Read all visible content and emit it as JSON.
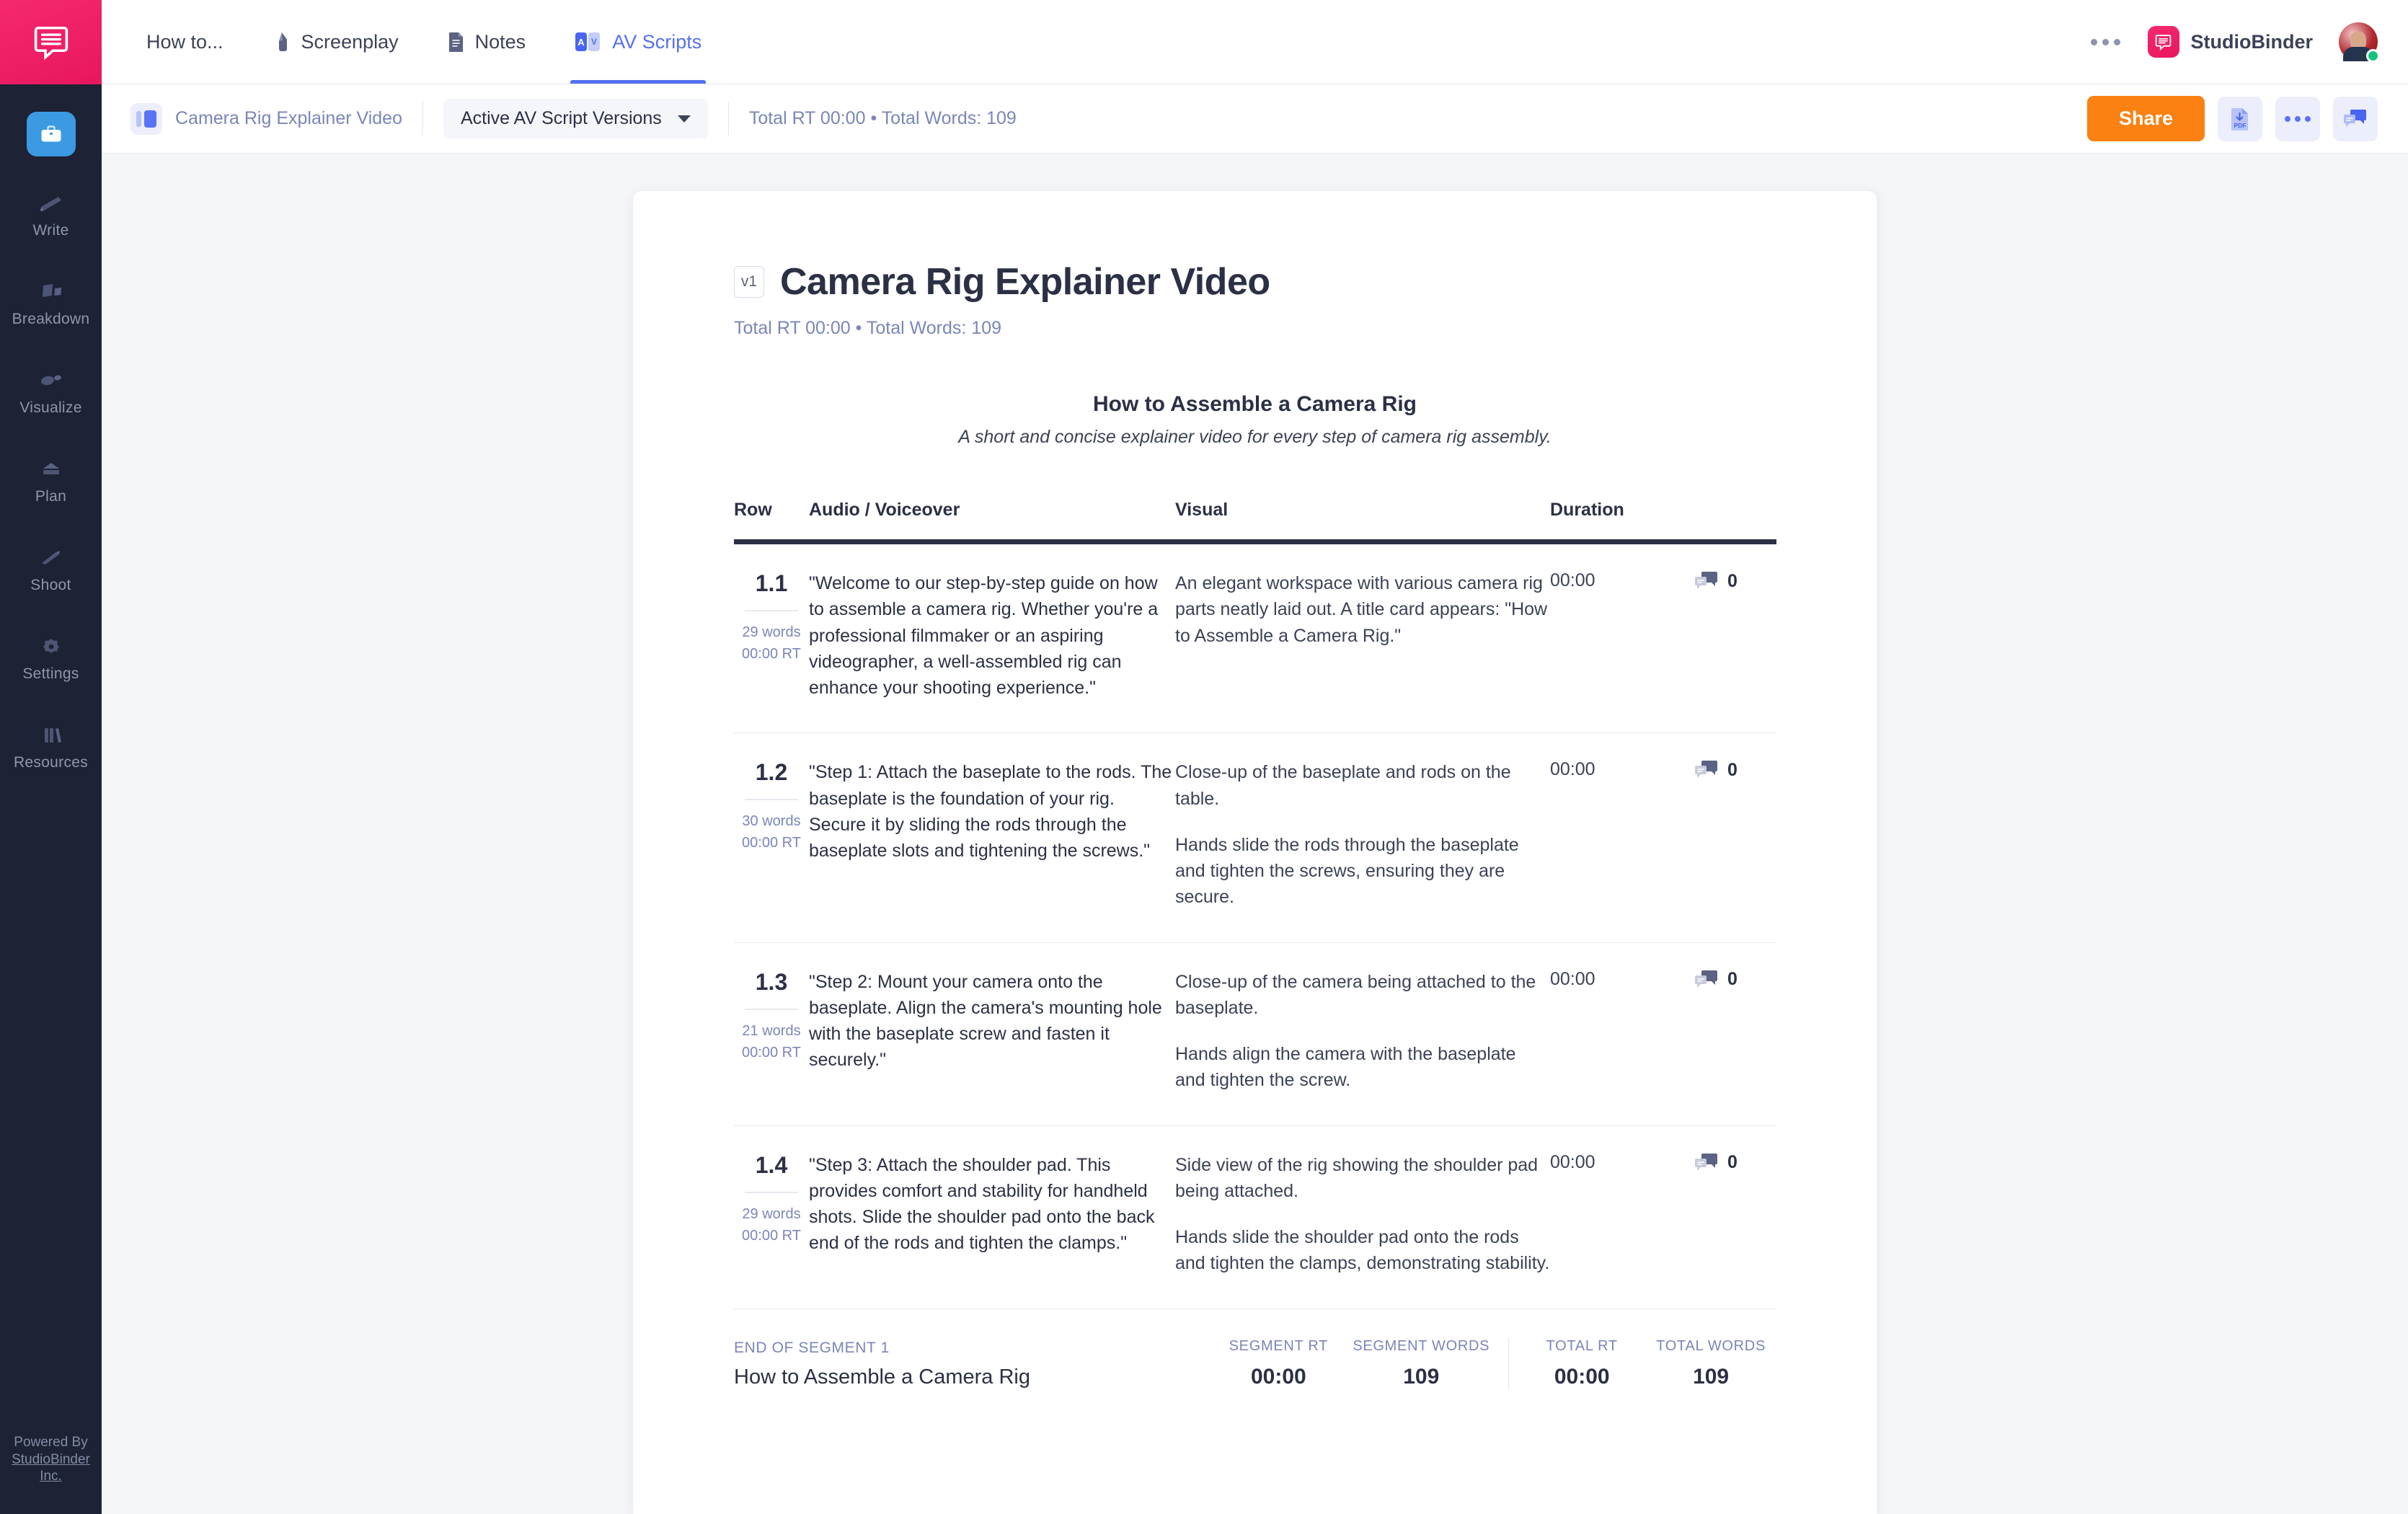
{
  "app": {
    "brand_name": "StudioBinder",
    "logo_icon": "studiobinder-chat-logo",
    "powered_by_line1": "Powered By",
    "powered_by_line2": "StudioBinder Inc."
  },
  "rail": {
    "active_icon": "briefcase-icon",
    "items": [
      {
        "label": "Write",
        "icon": "pencil-icon"
      },
      {
        "label": "Breakdown",
        "icon": "cards-icon"
      },
      {
        "label": "Visualize",
        "icon": "shapes-icon"
      },
      {
        "label": "Plan",
        "icon": "calendar-icon"
      },
      {
        "label": "Shoot",
        "icon": "clapper-icon"
      },
      {
        "label": "Settings",
        "icon": "gear-icon"
      },
      {
        "label": "Resources",
        "icon": "books-icon"
      }
    ]
  },
  "topbar": {
    "tabs": [
      {
        "label": "How to...",
        "icon": "none",
        "active": false
      },
      {
        "label": "Screenplay",
        "icon": "pen-icon",
        "active": false
      },
      {
        "label": "Notes",
        "icon": "document-icon",
        "active": false
      },
      {
        "label": "AV Scripts",
        "icon": "av-icon",
        "active": true
      }
    ],
    "more_icon": "ellipsis-icon",
    "avatar_icon": "user-avatar",
    "status_color": "#17c27f"
  },
  "subbar": {
    "breadcrumb_icon": "columns-icon",
    "breadcrumb_label": "Camera Rig Explainer Video",
    "version_select_label": "Active AV Script Versions",
    "version_select_caret": "chevron-down-icon",
    "rt_summary": "Total RT 00:00 • Total Words: 109",
    "share_label": "Share",
    "pdf_icon": "download-pdf-icon",
    "more_icon": "ellipsis-icon",
    "comments_icon": "comments-icon",
    "share_color": "#fb8112"
  },
  "document": {
    "version_badge": "v1",
    "title": "Camera Rig Explainer Video",
    "subtitle": "Total RT 00:00 • Total Words: 109",
    "segment_title": "How to Assemble a Camera Rig",
    "segment_description": "A short and concise explainer video for every step of camera rig assembly.",
    "columns": {
      "row": "Row",
      "audio": "Audio / Voiceover",
      "visual": "Visual",
      "duration": "Duration"
    },
    "rows": [
      {
        "number": "1.1",
        "words": "29 words",
        "rt": "00:00 RT",
        "audio": "\"Welcome to our step-by-step guide on how to assemble a camera rig. Whether you're a professional filmmaker or an aspiring videographer, a well-assembled rig can enhance your shooting experience.\"",
        "visual_1": "An elegant workspace with various camera rig parts neatly laid out. A title card appears: \"How to Assemble a Camera Rig.\"",
        "visual_2": "",
        "duration": "00:00",
        "comments": "0"
      },
      {
        "number": "1.2",
        "words": "30 words",
        "rt": "00:00 RT",
        "audio": "\"Step 1: Attach the baseplate to the rods. The baseplate is the foundation of your rig. Secure it by sliding the rods through the baseplate slots and tightening the screws.\"",
        "visual_1": "Close-up of the baseplate and rods on the table.",
        "visual_2": "Hands slide the rods through the baseplate and tighten the screws, ensuring they are secure.",
        "duration": "00:00",
        "comments": "0"
      },
      {
        "number": "1.3",
        "words": "21 words",
        "rt": "00:00 RT",
        "audio": "\"Step 2: Mount your camera onto the baseplate. Align the camera's mounting hole with the baseplate screw and fasten it securely.\"",
        "visual_1": "Close-up of the camera being attached to the baseplate.",
        "visual_2": "Hands align the camera with the baseplate and tighten the screw.",
        "duration": "00:00",
        "comments": "0"
      },
      {
        "number": "1.4",
        "words": "29 words",
        "rt": "00:00 RT",
        "audio": "\"Step 3: Attach the shoulder pad. This provides comfort and stability for handheld shots. Slide the shoulder pad onto the back end of the rods and tighten the clamps.\"",
        "visual_1": "Side view of the rig showing the shoulder pad being attached.",
        "visual_2": "Hands slide the shoulder pad onto the rods and tighten the clamps, demonstrating stability.",
        "duration": "00:00",
        "comments": "0"
      }
    ],
    "footer": {
      "end_label": "END OF SEGMENT 1",
      "end_title": "How to Assemble a Camera Rig",
      "segment_rt_label": "SEGMENT RT",
      "segment_rt_value": "00:00",
      "segment_words_label": "SEGMENT WORDS",
      "segment_words_value": "109",
      "total_rt_label": "TOTAL RT",
      "total_rt_value": "00:00",
      "total_words_label": "TOTAL WORDS",
      "total_words_value": "109"
    }
  }
}
